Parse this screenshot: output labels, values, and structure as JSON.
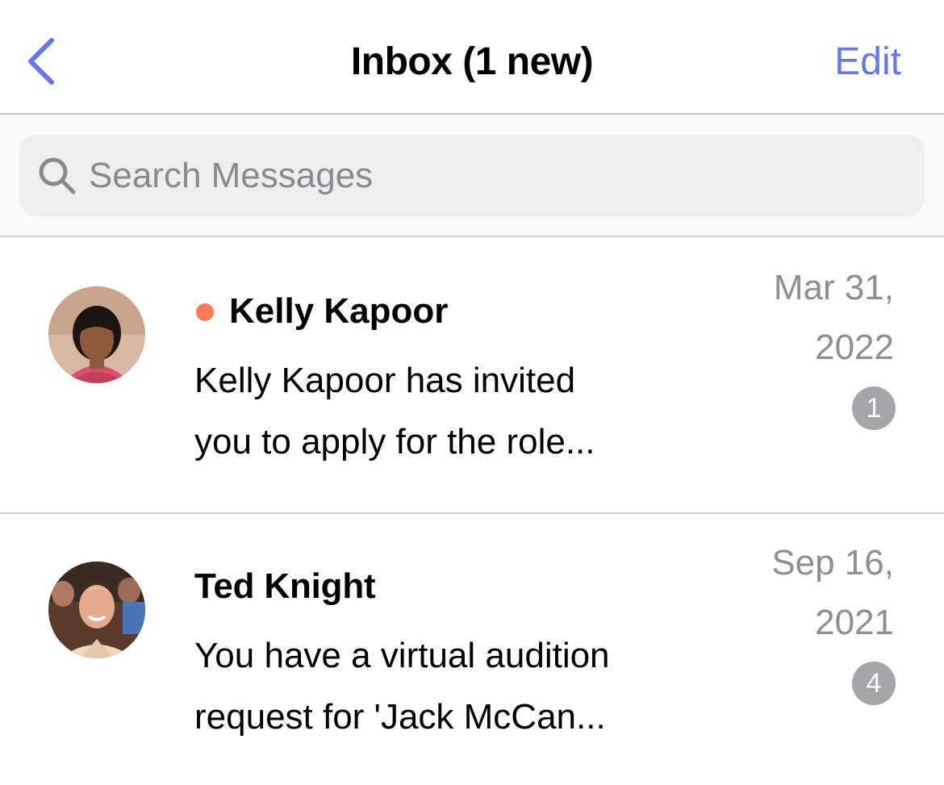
{
  "colors": {
    "accent": "#6478e6",
    "unread_dot": "#ff7a59",
    "badge": "#a5a5aa",
    "secondary_text": "#8e8e93"
  },
  "header": {
    "back_icon": "chevron-left-icon",
    "title": "Inbox (1 new)",
    "edit_label": "Edit"
  },
  "search": {
    "icon": "search-icon",
    "placeholder": "Search Messages",
    "value": ""
  },
  "messages": [
    {
      "sender": "Kelly Kapoor",
      "unread": true,
      "preview_lines": [
        "Kelly Kapoor has invited",
        "you to apply for the role..."
      ],
      "date_lines": [
        "Mar 31,",
        "2022"
      ],
      "badge": "1",
      "avatar": "avatar-photo"
    },
    {
      "sender": "Ted Knight",
      "unread": false,
      "preview_lines": [
        "You have a virtual audition",
        "request for 'Jack McCan..."
      ],
      "date_lines": [
        "Sep 16,",
        "2021"
      ],
      "badge": "4",
      "avatar": "avatar-photo"
    }
  ]
}
